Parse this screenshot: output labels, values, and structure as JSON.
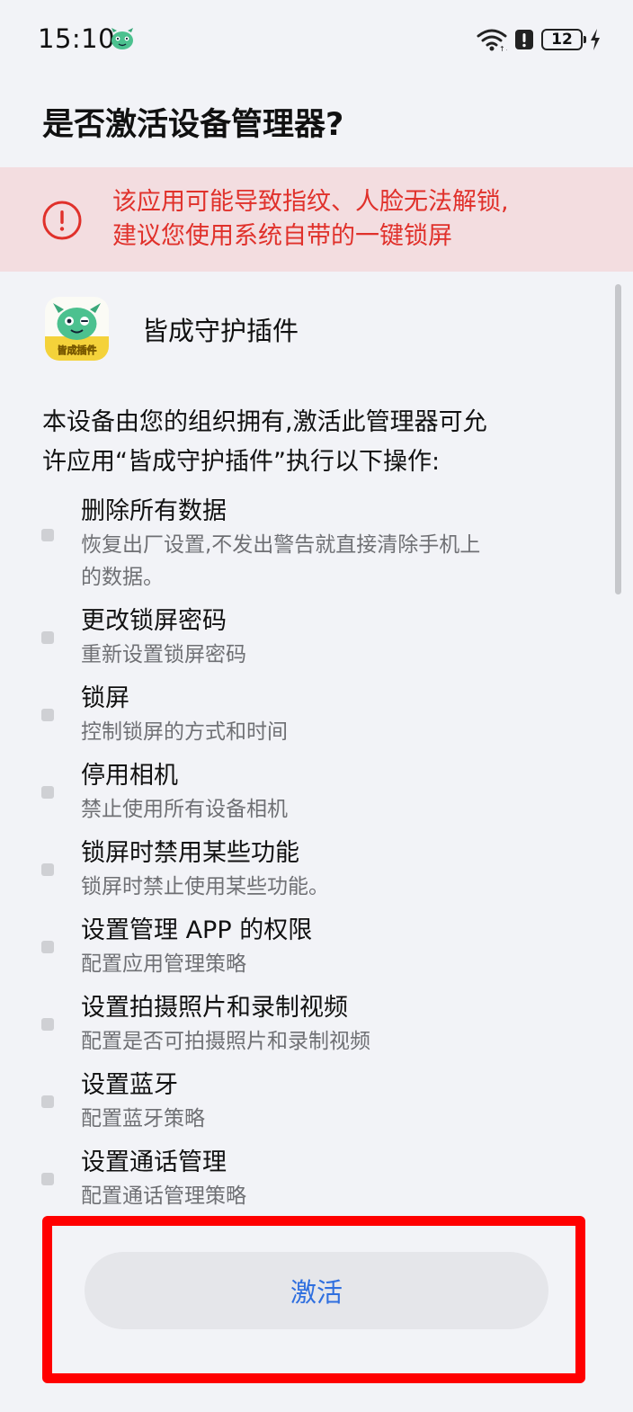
{
  "status_bar": {
    "time": "15:10",
    "app_icon": "jicheng-mascot-icon",
    "battery_level": "12",
    "icons": [
      "wifi-icon",
      "alert-icon",
      "battery-icon",
      "charging-icon"
    ]
  },
  "dialog": {
    "title": "是否激活设备管理器?",
    "warning": {
      "lines": [
        "该应用可能导致指纹、人脸无法解锁,",
        "建议您使用系统自带的一键锁屏"
      ],
      "color": "#e0312b",
      "background": "#f3dde0"
    },
    "app": {
      "name": "皆成守护插件",
      "icon_label": "皆成插件"
    },
    "description_lines": [
      "本设备由您的组织拥有,激活此管理器可允",
      "许应用“皆成守护插件”执行以下操作:"
    ],
    "permissions": [
      {
        "title": "删除所有数据",
        "desc_lines": [
          "恢复出厂设置,不发出警告就直接清除手机上",
          "的数据。"
        ]
      },
      {
        "title": "更改锁屏密码",
        "desc_lines": [
          "重新设置锁屏密码"
        ]
      },
      {
        "title": "锁屏",
        "desc_lines": [
          "控制锁屏的方式和时间"
        ]
      },
      {
        "title": "停用相机",
        "desc_lines": [
          "禁止使用所有设备相机"
        ]
      },
      {
        "title": "锁屏时禁用某些功能",
        "desc_lines": [
          "锁屏时禁止使用某些功能。"
        ]
      },
      {
        "title": "设置管理 APP 的权限",
        "desc_lines": [
          "配置应用管理策略"
        ]
      },
      {
        "title": "设置拍摄照片和录制视频",
        "desc_lines": [
          "配置是否可拍摄照片和录制视频"
        ]
      },
      {
        "title": "设置蓝牙",
        "desc_lines": [
          "配置蓝牙策略"
        ]
      },
      {
        "title": "设置通话管理",
        "desc_lines": [
          "配置通话管理策略"
        ]
      }
    ],
    "activate_button": "激活",
    "accent_color": "#2f6fdf",
    "highlight_color": "#ff0000"
  }
}
